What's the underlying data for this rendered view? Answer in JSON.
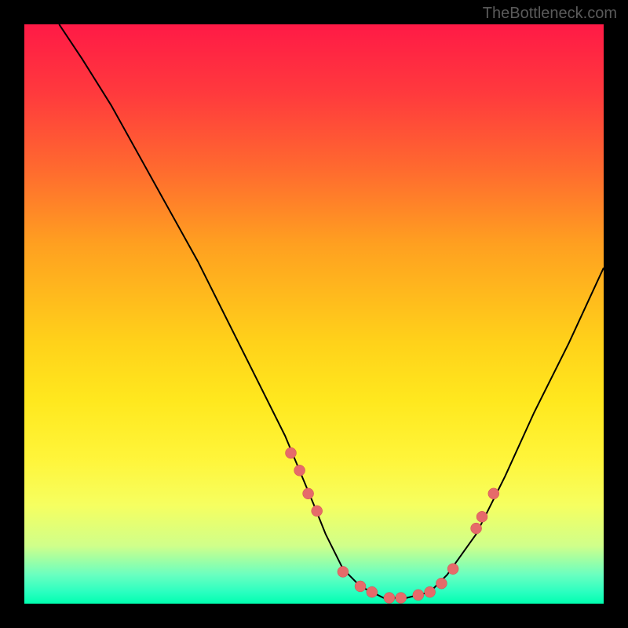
{
  "watermark": "TheBottleneck.com",
  "chart_data": {
    "type": "line",
    "title": "",
    "xlabel": "",
    "ylabel": "",
    "xlim": [
      0,
      100
    ],
    "ylim": [
      0,
      100
    ],
    "series": [
      {
        "name": "curve",
        "x": [
          6,
          10,
          15,
          20,
          25,
          30,
          35,
          40,
          45,
          50,
          52,
          55,
          58,
          62,
          66,
          70,
          73,
          78,
          83,
          88,
          94,
          100
        ],
        "y": [
          100,
          94,
          86,
          77,
          68,
          59,
          49,
          39,
          29,
          17,
          12,
          6,
          3,
          1,
          1,
          2,
          5,
          12,
          22,
          33,
          45,
          58
        ]
      }
    ],
    "markers": {
      "name": "dots",
      "x": [
        46,
        47.5,
        49,
        50.5,
        55,
        58,
        60,
        63,
        65,
        68,
        70,
        72,
        74,
        78,
        79,
        81
      ],
      "y": [
        26,
        23,
        19,
        16,
        5.5,
        3,
        2,
        1,
        1,
        1.5,
        2,
        3.5,
        6,
        13,
        15,
        19
      ]
    },
    "colors": {
      "curve": "#000000",
      "marker_fill": "#e66a6a",
      "gradient_top": "#ff1a46",
      "gradient_bottom": "#00ffb0"
    }
  }
}
